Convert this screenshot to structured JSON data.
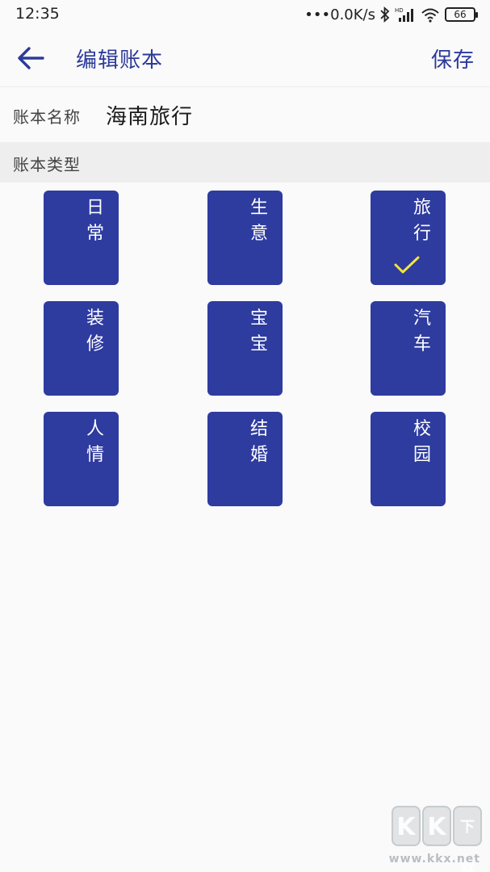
{
  "status_bar": {
    "time": "12:35",
    "network_speed": "•••0.0K/s",
    "battery": "66"
  },
  "app_bar": {
    "title": "编辑账本",
    "save_label": "保存",
    "back_icon": "arrow-left-icon"
  },
  "name_row": {
    "label": "账本名称",
    "value": "海南旅行"
  },
  "type_section": {
    "header": "账本类型",
    "selected": "旅行",
    "accent_color": "#2e3b9f",
    "check_color": "#f5e53b",
    "types": [
      {
        "label": "日常",
        "selected": false
      },
      {
        "label": "生意",
        "selected": false
      },
      {
        "label": "旅行",
        "selected": true
      },
      {
        "label": "装修",
        "selected": false
      },
      {
        "label": "宝宝",
        "selected": false
      },
      {
        "label": "汽车",
        "selected": false
      },
      {
        "label": "人情",
        "selected": false
      },
      {
        "label": "结婚",
        "selected": false
      },
      {
        "label": "校园",
        "selected": false
      }
    ]
  },
  "watermark": {
    "logo_text": [
      "K",
      "K",
      "下载"
    ],
    "url": "www.kkx.net"
  }
}
